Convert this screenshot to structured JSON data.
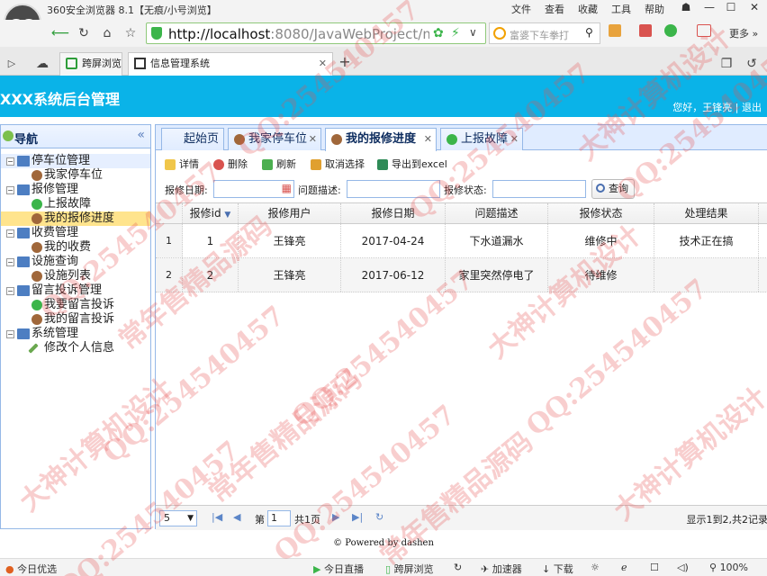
{
  "browser": {
    "window_title": "360安全浏览器 8.1【无痕/小号浏览】",
    "menu": [
      "文件",
      "查看",
      "收藏",
      "工具",
      "帮助"
    ],
    "url_host": "http://localhost",
    "url_path": ":8080/JavaWebProject/main_",
    "search_placeholder": "富婆下车拳打",
    "more_label": "更多",
    "tabs": [
      {
        "label": "跨屏浏览"
      },
      {
        "label": "信息管理系统"
      }
    ],
    "status_left": "今日优选",
    "status_items": [
      "今日直播",
      "跨屏浏览",
      "加速器",
      "下载"
    ],
    "zoom": "100%"
  },
  "app": {
    "title": "XXX系统后台管理",
    "user_text": "您好，王锋亮",
    "logout": "退出"
  },
  "sidebar": {
    "title": "导航",
    "collapse_icon": "«",
    "groups": [
      {
        "label": "停车位管理",
        "items": [
          "我家停车位"
        ]
      },
      {
        "label": "报修管理",
        "items": [
          "上报故障",
          "我的报修进度"
        ]
      },
      {
        "label": "收费管理",
        "items": [
          "我的收费"
        ]
      },
      {
        "label": "设施查询",
        "items": [
          "设施列表"
        ]
      },
      {
        "label": "留言投诉管理",
        "items": [
          "我要留言投诉",
          "我的留言投诉"
        ]
      },
      {
        "label": "系统管理",
        "items": [
          "修改个人信息"
        ]
      }
    ]
  },
  "tabs": [
    {
      "label": "起始页"
    },
    {
      "label": "我家停车位"
    },
    {
      "label": "我的报修进度"
    },
    {
      "label": "上报故障"
    }
  ],
  "toolbar": {
    "detail": "详情",
    "delete": "删除",
    "refresh": "刷新",
    "unselect": "取消选择",
    "export": "导出到excel"
  },
  "filters": {
    "date_label": "报修日期:",
    "desc_label": "问题描述:",
    "status_label": "报修状态:",
    "query": "查询"
  },
  "grid": {
    "columns": [
      "报修id",
      "报修用户",
      "报修日期",
      "问题描述",
      "报修状态",
      "处理结果"
    ],
    "rows": [
      {
        "num": "1",
        "id": "1",
        "user": "王锋亮",
        "date": "2017-04-24",
        "desc": "下水道漏水",
        "status": "维修中",
        "result": "技术正在搞"
      },
      {
        "num": "2",
        "id": "2",
        "user": "王锋亮",
        "date": "2017-06-12",
        "desc": "家里突然停电了",
        "status": "待维修",
        "result": ""
      }
    ]
  },
  "pager": {
    "page_size": "5",
    "page_prefix": "第",
    "page_value": "1",
    "page_suffix": "共1页",
    "info": "显示1到2,共2记录"
  },
  "footer": "© Powered by dashen",
  "watermarks": [
    "QQ:254540457",
    "常年售精品源码",
    "大神计算机设计"
  ],
  "colors": {
    "header": "#0ab3e8",
    "border": "#95b8e7",
    "selected": "#ffe48d"
  }
}
